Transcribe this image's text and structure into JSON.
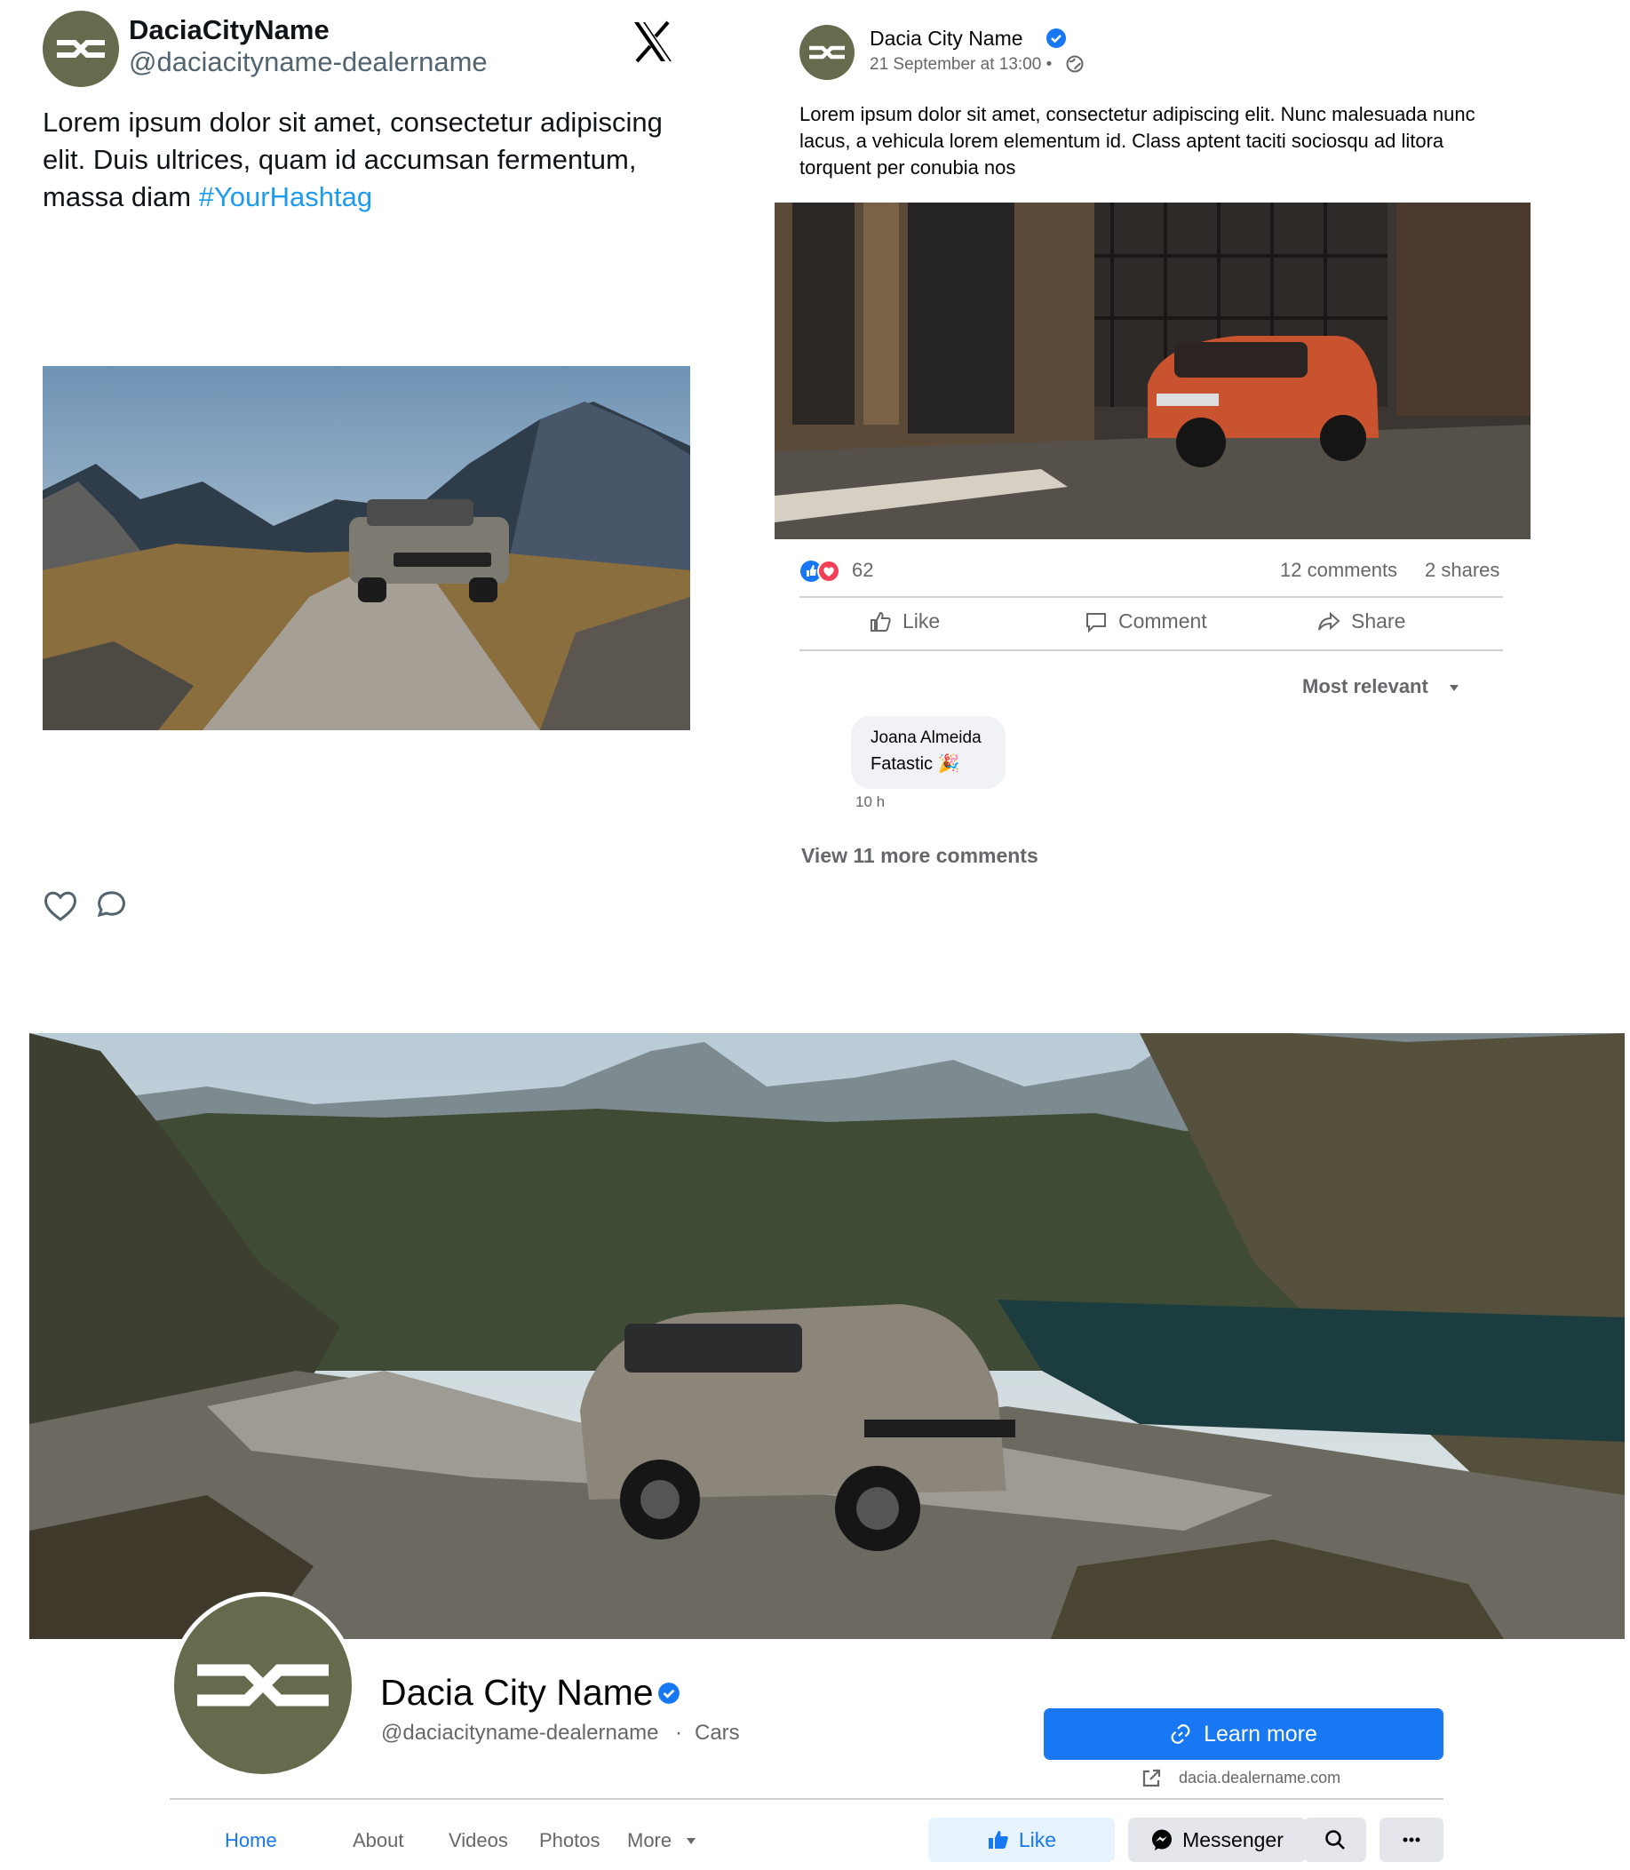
{
  "brand_color": "#666b4d",
  "x_post": {
    "name": "DaciaCityName",
    "handle": "@daciacityname-dealername",
    "text": "Lorem ipsum dolor sit amet, consectetur adipiscing elit. Duis ultrices, quam id accumsan fermentum, massa diam ",
    "hashtag": "#YourHashtag",
    "icons": {
      "logo": "x-logo-icon",
      "like": "heart-icon",
      "reply": "reply-icon"
    }
  },
  "fb_post": {
    "name": "Dacia City Name",
    "date": "21 September at 13:00 •",
    "text": "Lorem ipsum dolor sit amet, consectetur adipiscing elit. Nunc malesuada nunc lacus, a vehicula lorem elementum id. Class aptent taciti sociosqu ad litora torquent per conubia nos",
    "reaction_count": "62",
    "comments_count": "12 comments",
    "shares_count": "2 shares",
    "actions": {
      "like": "Like",
      "comment": "Comment",
      "share": "Share"
    },
    "sort_label": "Most relevant",
    "comment": {
      "author": "Joana Almeida",
      "text": "Fatastic 🎉",
      "time": "10 h"
    },
    "view_more": "View 11 more comments"
  },
  "fb_page": {
    "name": "Dacia City Name",
    "handle": "@daciacityname-dealername",
    "separator": "·",
    "category": "Cars",
    "cta": "Learn more",
    "website": "dacia.dealername.com",
    "tabs": [
      "Home",
      "About",
      "Videos",
      "Photos",
      "More"
    ],
    "buttons": {
      "like": "Like",
      "messenger": "Messenger"
    },
    "accent": "#1877f2"
  }
}
